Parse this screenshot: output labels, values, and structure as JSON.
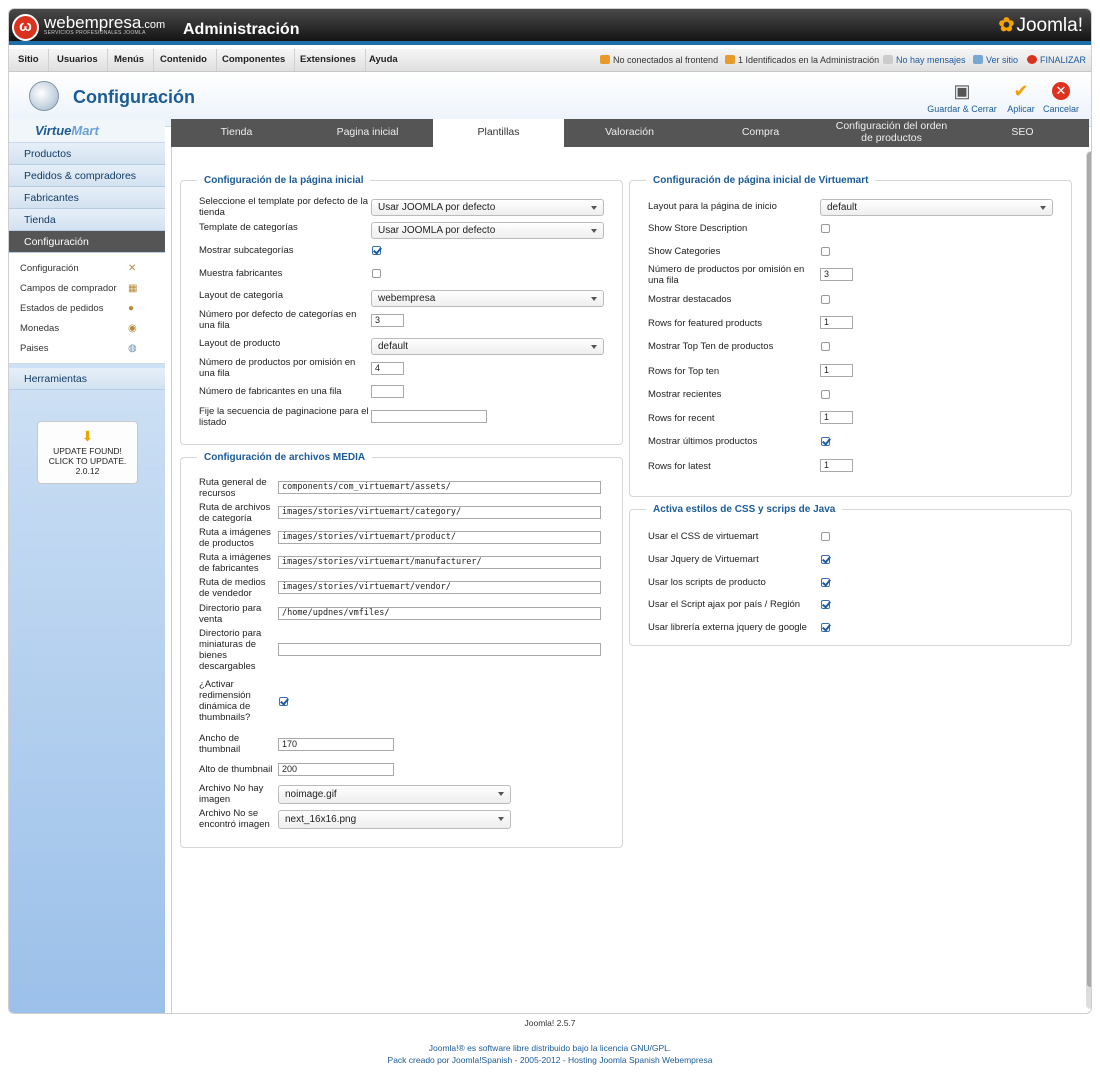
{
  "header": {
    "brand": "webempresa",
    "brand_suffix": ".com",
    "brand_sub": "SERVICIOS PROFESIONALES JOOMLA",
    "title": "Administración",
    "joomla_logo": "Joomla!"
  },
  "menu": {
    "items": [
      "Sitio",
      "Usuarios",
      "Menús",
      "Contenido",
      "Componentes",
      "Extensiones",
      "Ayuda"
    ],
    "status": {
      "frontend": "No conectados al frontend",
      "admin": "1 Identificados en la Administración",
      "messages": "No hay mensajes",
      "view_site": "Ver sitio",
      "logout": "FINALIZAR"
    }
  },
  "toolbar": {
    "title": "Configuración",
    "save_close": "Guardar & Cerrar",
    "apply": "Aplicar",
    "cancel": "Cancelar"
  },
  "sidebar": {
    "logo": "VirtueMart",
    "main": [
      "Productos",
      "Pedidos & compradores",
      "Fabricantes",
      "Tienda",
      "Configuración"
    ],
    "sub": [
      "Configuración",
      "Campos de comprador",
      "Estados de pedidos",
      "Monedas",
      "Paises"
    ],
    "tools": "Herramientas",
    "update": {
      "line1": "UPDATE FOUND!",
      "line2": "CLICK TO UPDATE.",
      "version": "2.0.12"
    }
  },
  "tabs": [
    "Tienda",
    "Pagina inicial",
    "Plantillas",
    "Valoración",
    "Compra",
    "Configuración del orden de productos",
    "SEO"
  ],
  "home_cfg": {
    "legend": "Configuración de la página inicial",
    "default_template_label": "Seleccione el template por defecto de la tienda",
    "default_template": "Usar JOOMLA por defecto",
    "category_template_label": "Template de categorías",
    "category_template": "Usar JOOMLA por defecto",
    "show_subcats_label": "Mostrar subcategorías",
    "show_manufacturers_label": "Muestra fabricantes",
    "category_layout_label": "Layout de categoría",
    "category_layout": "webempresa",
    "cats_per_row_label": "Número por defecto de categorías en una fila",
    "cats_per_row": "3",
    "product_layout_label": "Layout de producto",
    "product_layout": "default",
    "products_per_row_label": "Número de productos por omisión en una fila",
    "products_per_row": "4",
    "manufacturers_per_row_label": "Número de fabricantes en una fila",
    "manufacturers_per_row": "",
    "pagination_label": "Fije la secuencia de paginacione para el listado",
    "pagination": ""
  },
  "media_cfg": {
    "legend": "Configuración de archivos MEDIA",
    "assets_label": "Ruta general de recursos",
    "assets": "components/com_virtuemart/assets/",
    "cat_label": "Ruta de archivos de categoría",
    "cat": "images/stories/virtuemart/category/",
    "prod_label": "Ruta a imágenes de productos",
    "prod": "images/stories/virtuemart/product/",
    "manuf_label": "Ruta a imágenes de fabricantes",
    "manuf": "images/stories/virtuemart/manufacturer/",
    "vendor_label": "Ruta de medios de vendedor",
    "vendor": "images/stories/virtuemart/vendor/",
    "sale_label": "Directorio para venta",
    "sale": "/home/updnes/vmfiles/",
    "thumbs_label": "Directorio para miniaturas de bienes descargables",
    "thumbs": "",
    "resize_label": "¿Activar redimensión dinámica de thumbnails?",
    "thumb_w_label": "Ancho de thumbnail",
    "thumb_w": "170",
    "thumb_h_label": "Alto de thumbnail",
    "thumb_h": "200",
    "noimg_label": "Archivo No hay imagen",
    "noimg": "noimage.gif",
    "notfound_label": "Archivo No se encontró imagen",
    "notfound": "next_16x16.png"
  },
  "vm_home": {
    "legend": "Configuración de página inicial de Virtuemart",
    "layout_label": "Layout para la página de inicio",
    "layout": "default",
    "store_desc": "Show Store Description",
    "show_cats": "Show Categories",
    "prods_row_label": "Número de productos por omisión en una fila",
    "prods_row": "3",
    "featured": "Mostrar destacados",
    "rows_featured": "Rows for featured products",
    "rows_featured_val": "1",
    "topten": "Mostrar Top Ten de productos",
    "rows_topten": "Rows for Top ten",
    "rows_topten_val": "1",
    "recent": "Mostrar recientes",
    "rows_recent": "Rows for recent",
    "rows_recent_val": "1",
    "latest": "Mostrar últimos productos",
    "rows_latest": "Rows for latest",
    "rows_latest_val": "1"
  },
  "css_js": {
    "legend": "Activa estilos de CSS y scrips de Java",
    "css": "Usar el CSS de virtuemart",
    "jquery": "Usar Jquery de Virtuemart",
    "product_scripts": "Usar los scripts de producto",
    "ajax": "Usar el Script ajax por país / Región",
    "google": "Usar librería externa jquery de google"
  },
  "footer": {
    "version": "Joomla! 2.5.7",
    "license": "Joomla!® es software libre distribuido bajo la licencia GNU/GPL.",
    "credit": "Pack creado por Joomla!Spanish - 2005-2012 - Hosting Joomla Spanish Webempresa"
  }
}
